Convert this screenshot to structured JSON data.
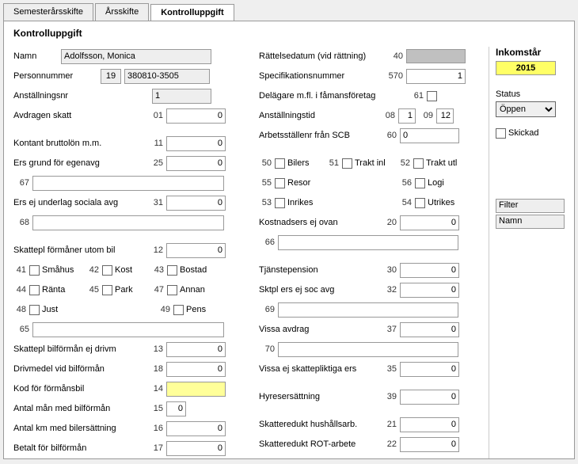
{
  "tabs": {
    "t0": "Semesterårsskifte",
    "t1": "Årsskifte",
    "t2": "Kontrolluppgift"
  },
  "panel_title": "Kontrolluppgift",
  "left": {
    "namn_lbl": "Namn",
    "namn_val": "Adolfsson, Monica",
    "personnr_lbl": "Personnummer",
    "personnr_prefix": "19",
    "personnr_val": "380810-3505",
    "anstnr_lbl": "Anställningsnr",
    "anstnr_val": "1",
    "avdragen_lbl": "Avdragen skatt",
    "avdragen_num": "01",
    "avdragen_val": "0",
    "kontant_lbl": "Kontant bruttolön m.m.",
    "kontant_num": "11",
    "kontant_val": "0",
    "ersgrund_lbl": "Ers grund för egenavg",
    "ersgrund_num": "25",
    "ersgrund_val": "0",
    "r67_num": "67",
    "r67_val": "",
    "ersej_lbl": "Ers ej underlag sociala avg",
    "ersej_num": "31",
    "ersej_val": "0",
    "r68_num": "68",
    "r68_val": "",
    "skatteplform_lbl": "Skattepl förmåner utom bil",
    "skatteplform_num": "12",
    "skatteplform_val": "0",
    "c41_num": "41",
    "c41_lbl": "Småhus",
    "c42_num": "42",
    "c42_lbl": "Kost",
    "c43_num": "43",
    "c43_lbl": "Bostad",
    "c44_num": "44",
    "c44_lbl": "Ränta",
    "c45_num": "45",
    "c45_lbl": "Park",
    "c47_num": "47",
    "c47_lbl": "Annan",
    "c48_num": "48",
    "c48_lbl": "Just",
    "c49_num": "49",
    "c49_lbl": "Pens",
    "r65_num": "65",
    "r65_val": "",
    "bilform_lbl": "Skattepl bilförmån ej drivm",
    "bilform_num": "13",
    "bilform_val": "0",
    "drivmedel_lbl": "Drivmedel vid bilförmån",
    "drivmedel_num": "18",
    "drivmedel_val": "0",
    "kod_lbl": "Kod för förmånsbil",
    "kod_num": "14",
    "kod_val": "",
    "antalman_lbl": "Antal mån med bilförmån",
    "antalman_num": "15",
    "antalman_val": "0",
    "antalkm_lbl": "Antal km med bilersättning",
    "antalkm_num": "16",
    "antalkm_val": "0",
    "betalt_lbl": "Betalt för bilförmån",
    "betalt_num": "17",
    "betalt_val": "0"
  },
  "mid": {
    "rattelse_lbl": "Rättelsedatum (vid rättning)",
    "rattelse_num": "40",
    "spec_lbl": "Specifikationsnummer",
    "spec_num": "570",
    "spec_val": "1",
    "delagare_lbl": "Delägare m.fl. i fåmansföretag",
    "delagare_num": "61",
    "anst_lbl": "Anställningstid",
    "anst_num1": "08",
    "anst_val1": "1",
    "anst_num2": "09",
    "anst_val2": "12",
    "arbets_lbl": "Arbetsställenr från SCB",
    "arbets_num": "60",
    "arbets_val": "0",
    "c50_num": "50",
    "c50_lbl": "Bilers",
    "c51_num": "51",
    "c51_lbl": "Trakt inl",
    "c52_num": "52",
    "c52_lbl": "Trakt utl",
    "c55_num": "55",
    "c55_lbl": "Resor",
    "c56_num": "56",
    "c56_lbl": "Logi",
    "c53_num": "53",
    "c53_lbl": "Inrikes",
    "c54_num": "54",
    "c54_lbl": "Utrikes",
    "kostn_lbl": "Kostnadsers ej ovan",
    "kostn_num": "20",
    "kostn_val": "0",
    "r66_num": "66",
    "r66_val": "",
    "tjanst_lbl": "Tjänstepension",
    "tjanst_num": "30",
    "tjanst_val": "0",
    "sktpl_lbl": "Sktpl ers ej soc avg",
    "sktpl_num": "32",
    "sktpl_val": "0",
    "r69_num": "69",
    "r69_val": "",
    "vissaavd_lbl": "Vissa avdrag",
    "vissaavd_num": "37",
    "vissaavd_val": "0",
    "r70_num": "70",
    "r70_val": "",
    "vissaej_lbl": "Vissa ej skattepliktiga ers",
    "vissaej_num": "35",
    "vissaej_val": "0",
    "hyres_lbl": "Hyresersättning",
    "hyres_num": "39",
    "hyres_val": "0",
    "skredhush_lbl": "Skatteredukt hushållsarb.",
    "skredhush_num": "21",
    "skredhush_val": "0",
    "skredrot_lbl": "Skatteredukt ROT-arbete",
    "skredrot_num": "22",
    "skredrot_val": "0"
  },
  "right": {
    "inkomstar_lbl": "Inkomstår",
    "inkomstar_val": "2015",
    "status_lbl": "Status",
    "status_val": "Öppen",
    "skickad_lbl": "Skickad",
    "filter_lbl": "Filter",
    "namn_lbl": "Namn"
  }
}
